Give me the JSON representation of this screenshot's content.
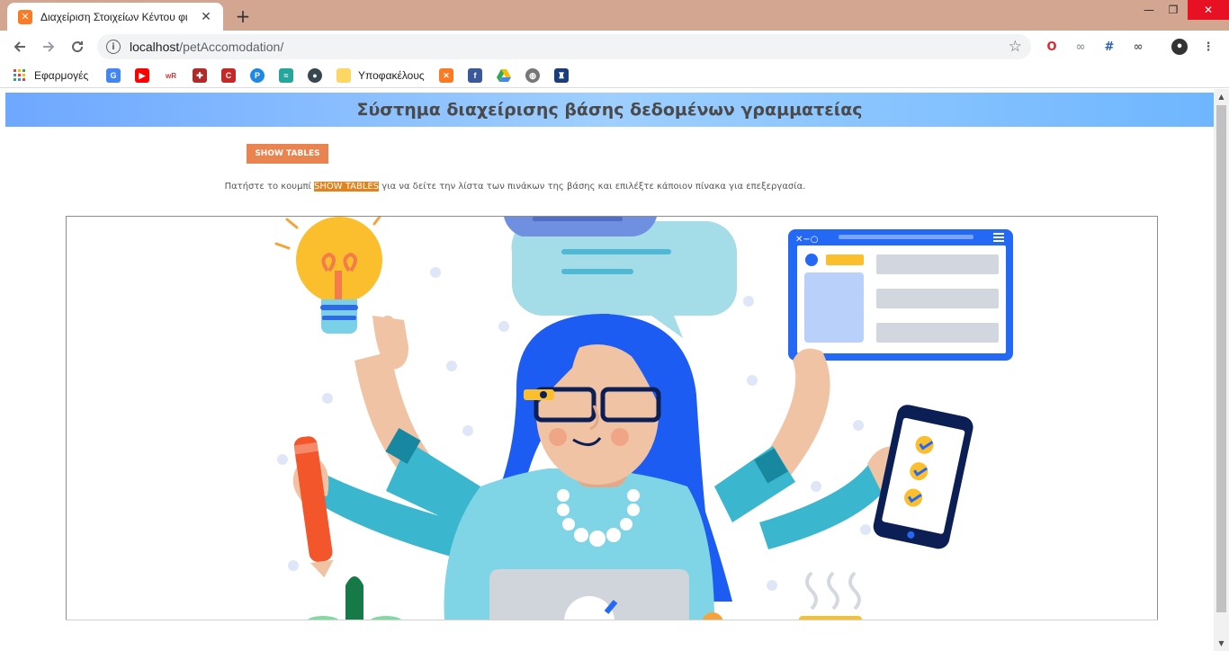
{
  "browser": {
    "tab_title": "Διαχείριση Στοιχείων Κέντου φι",
    "tab_favicon": "xampp-icon",
    "url_host": "localhost",
    "url_path": "/petAccomodation/",
    "bookmarks": [
      {
        "label": "Εφαρμογές",
        "icon": "apps-grid-icon"
      },
      {
        "label": "",
        "icon": "translate-icon"
      },
      {
        "label": "",
        "icon": "youtube-icon"
      },
      {
        "label": "",
        "icon": "wordreference-icon"
      },
      {
        "label": "",
        "icon": "university-crest-icon"
      },
      {
        "label": "",
        "icon": "c-icon"
      },
      {
        "label": "",
        "icon": "p-icon"
      },
      {
        "label": "",
        "icon": "book-icon"
      },
      {
        "label": "",
        "icon": "circle-logo-icon"
      },
      {
        "label": "Υποφακέλους",
        "icon": "folder-icon"
      },
      {
        "label": "",
        "icon": "xampp-icon"
      },
      {
        "label": "",
        "icon": "facebook-icon"
      },
      {
        "label": "",
        "icon": "drive-icon"
      },
      {
        "label": "",
        "icon": "globe-icon"
      },
      {
        "label": "",
        "icon": "crest-icon"
      }
    ]
  },
  "page": {
    "heading": "Σύστημα διαχείρισης βάσης δεδομένων γραμματείας",
    "show_tables_button": "SHOW TABLES",
    "instructions": {
      "before": "Πατήστε το κουμπί ",
      "highlight": "SHOW TABLES",
      "after": " για να δείτε την λίστα των πινάκων της βάσης και επιλέξτε κάποιον πίνακα για επεξεργασία."
    },
    "illustration": "multitasking-woman-illustration"
  },
  "colors": {
    "tabstrip": "#d2a690",
    "button": "#e9834f",
    "highlight": "#e0841f",
    "banner_start": "#6ea8ff",
    "banner_end": "#9ecfff"
  }
}
